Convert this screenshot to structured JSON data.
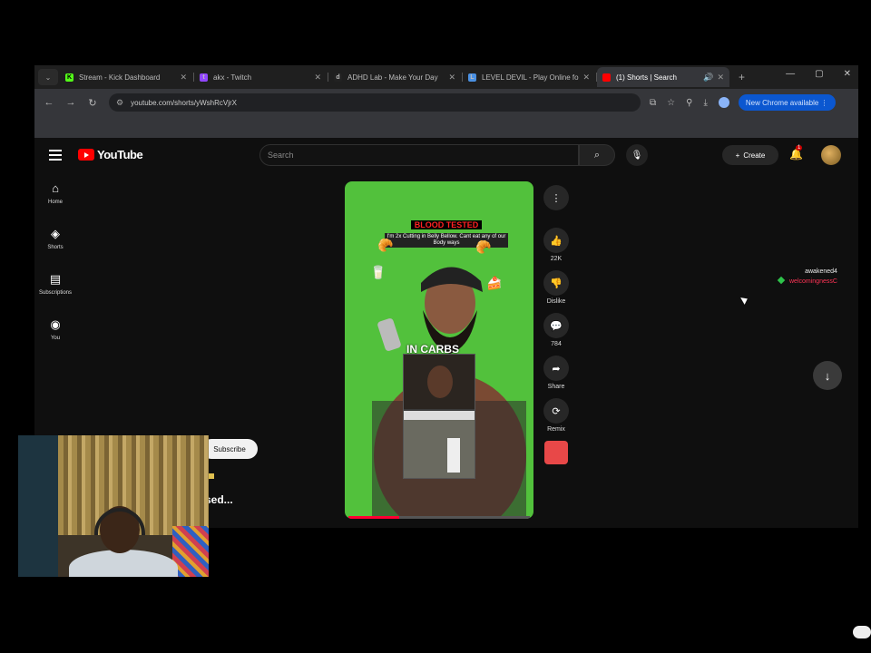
{
  "browser": {
    "tabs": [
      {
        "label": "Stream - Kick Dashboard",
        "favicon": "K",
        "color": "#53fc18",
        "active": false
      },
      {
        "label": "akx - Twitch",
        "favicon": "t",
        "color": "#9146ff",
        "active": false
      },
      {
        "label": "ADHD Lab - Make Your Day",
        "favicon": "d",
        "color": "#ffffff",
        "active": false
      },
      {
        "label": "LEVEL DEVIL - Play Online for",
        "favicon": "L",
        "color": "#4a90e2",
        "active": false
      },
      {
        "label": "(1) Shorts | Search",
        "favicon": "",
        "color": "#ff0000",
        "active": true
      }
    ],
    "url": "youtube.com/shorts/yWshRcVjrX",
    "update_button": "New Chrome available",
    "window_controls": [
      "—",
      "▢",
      "✕"
    ]
  },
  "youtube": {
    "logo_text": "YouTube",
    "search_placeholder": "Search",
    "create_label": "Create",
    "notification_count": "1",
    "sidebar": [
      {
        "icon": "home-icon",
        "glyph": "⌂",
        "label": "Home"
      },
      {
        "icon": "shorts-icon",
        "glyph": "◈",
        "label": "Shorts"
      },
      {
        "icon": "subscriptions-icon",
        "glyph": "▤",
        "label": "Subscriptions"
      },
      {
        "icon": "you-icon",
        "glyph": "◉",
        "label": "You"
      }
    ],
    "video": {
      "banner_title": "BLOOD TESTED",
      "banner_subtitle": "I'm 2x Cutting in Belly Bellow. Cant eat any of our Body ways",
      "caption": "IN CARBS",
      "progress_fraction": 0.28
    },
    "actions": [
      {
        "name": "like-button",
        "glyph": "👍",
        "count": "22K"
      },
      {
        "name": "dislike-button",
        "glyph": "👎",
        "count": "Dislike"
      },
      {
        "name": "comments-button",
        "glyph": "💬",
        "count": "784"
      },
      {
        "name": "share-button",
        "glyph": "➦",
        "count": "Share"
      },
      {
        "name": "remix-button",
        "glyph": "⟳",
        "count": "Remix"
      }
    ],
    "chat": {
      "user": "awakened4",
      "message": "welcomingnessC"
    },
    "subscribe_label": "Subscribe",
    "partial_text": "sed..."
  },
  "colors": {
    "youtube_red": "#ff0000",
    "green_screen": "#52c13c",
    "progress": "#ff0033"
  }
}
